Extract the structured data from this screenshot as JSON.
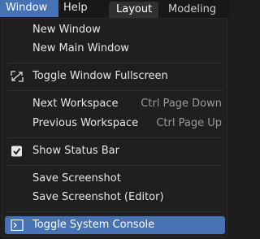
{
  "menubar": {
    "window_label": "Window",
    "help_label": "Help"
  },
  "workspace_tabs": {
    "layout_label": "Layout",
    "modeling_label": "Modeling"
  },
  "window_menu": {
    "items": [
      {
        "label": "New Window"
      },
      {
        "label": "New Main Window"
      },
      {
        "label": "Toggle Window Fullscreen",
        "icon": "fullscreen-icon"
      },
      {
        "label": "Next Workspace",
        "shortcut": "Ctrl Page Down"
      },
      {
        "label": "Previous Workspace",
        "shortcut": "Ctrl Page Up"
      },
      {
        "label": "Show Status Bar",
        "icon": "checkbox-checked-icon",
        "checked": true
      },
      {
        "label": "Save Screenshot"
      },
      {
        "label": "Save Screenshot (Editor)"
      },
      {
        "label": "Toggle System Console",
        "icon": "console-icon",
        "highlighted": true
      }
    ]
  },
  "colors": {
    "accent": "#4772b3",
    "menu_bg": "#1f1f1f",
    "shortcut_text": "#9a9a9a"
  }
}
